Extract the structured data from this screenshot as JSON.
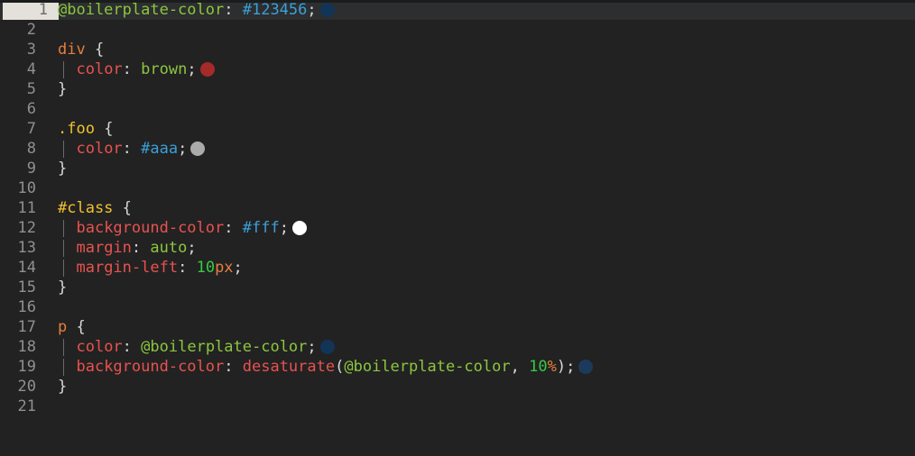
{
  "editor": {
    "language": "less",
    "background_color": "#222222",
    "active_line_background": "#2c2e2f",
    "gutter_text_color": "#8e9091",
    "active_gutter_background": "#e4e0da",
    "total_lines": 21,
    "active_line": 1
  },
  "lines": [
    {
      "number": "1",
      "active": true,
      "indent": false,
      "tokens": [
        {
          "text": "@boilerplate-color",
          "type": "var"
        },
        {
          "text": ":",
          "type": "punct"
        },
        {
          "text": " ",
          "type": "plain"
        },
        {
          "text": "#123456",
          "type": "hex"
        },
        {
          "text": ";",
          "type": "punct"
        }
      ],
      "swatch": "#123456"
    },
    {
      "number": "2",
      "active": false,
      "indent": false,
      "tokens": [],
      "swatch": null
    },
    {
      "number": "3",
      "active": false,
      "indent": false,
      "tokens": [
        {
          "text": "div",
          "type": "tag"
        },
        {
          "text": " ",
          "type": "plain"
        },
        {
          "text": "{",
          "type": "punct"
        }
      ],
      "swatch": null
    },
    {
      "number": "4",
      "active": false,
      "indent": true,
      "tokens": [
        {
          "text": "  ",
          "type": "plain"
        },
        {
          "text": "color",
          "type": "prop"
        },
        {
          "text": ":",
          "type": "punct"
        },
        {
          "text": " ",
          "type": "plain"
        },
        {
          "text": "brown",
          "type": "value"
        },
        {
          "text": ";",
          "type": "punct"
        }
      ],
      "swatch": "#a52a2a"
    },
    {
      "number": "5",
      "active": false,
      "indent": false,
      "tokens": [
        {
          "text": "}",
          "type": "punct"
        }
      ],
      "swatch": null
    },
    {
      "number": "6",
      "active": false,
      "indent": false,
      "tokens": [],
      "swatch": null
    },
    {
      "number": "7",
      "active": false,
      "indent": false,
      "tokens": [
        {
          "text": ".foo",
          "type": "selector"
        },
        {
          "text": " ",
          "type": "plain"
        },
        {
          "text": "{",
          "type": "punct"
        }
      ],
      "swatch": null
    },
    {
      "number": "8",
      "active": false,
      "indent": true,
      "tokens": [
        {
          "text": "  ",
          "type": "plain"
        },
        {
          "text": "color",
          "type": "prop"
        },
        {
          "text": ":",
          "type": "punct"
        },
        {
          "text": " ",
          "type": "plain"
        },
        {
          "text": "#aaa",
          "type": "hex"
        },
        {
          "text": ";",
          "type": "punct"
        }
      ],
      "swatch": "#aaaaaa"
    },
    {
      "number": "9",
      "active": false,
      "indent": false,
      "tokens": [
        {
          "text": "}",
          "type": "punct"
        }
      ],
      "swatch": null
    },
    {
      "number": "10",
      "active": false,
      "indent": false,
      "tokens": [],
      "swatch": null
    },
    {
      "number": "11",
      "active": false,
      "indent": false,
      "tokens": [
        {
          "text": "#class",
          "type": "selector"
        },
        {
          "text": " ",
          "type": "plain"
        },
        {
          "text": "{",
          "type": "punct"
        }
      ],
      "swatch": null
    },
    {
      "number": "12",
      "active": false,
      "indent": true,
      "tokens": [
        {
          "text": "  ",
          "type": "plain"
        },
        {
          "text": "background-color",
          "type": "prop"
        },
        {
          "text": ":",
          "type": "punct"
        },
        {
          "text": " ",
          "type": "plain"
        },
        {
          "text": "#fff",
          "type": "hex"
        },
        {
          "text": ";",
          "type": "punct"
        }
      ],
      "swatch": "#ffffff"
    },
    {
      "number": "13",
      "active": false,
      "indent": true,
      "tokens": [
        {
          "text": "  ",
          "type": "plain"
        },
        {
          "text": "margin",
          "type": "prop"
        },
        {
          "text": ":",
          "type": "punct"
        },
        {
          "text": " ",
          "type": "plain"
        },
        {
          "text": "auto",
          "type": "value"
        },
        {
          "text": ";",
          "type": "punct"
        }
      ],
      "swatch": null
    },
    {
      "number": "14",
      "active": false,
      "indent": true,
      "tokens": [
        {
          "text": "  ",
          "type": "plain"
        },
        {
          "text": "margin-left",
          "type": "prop"
        },
        {
          "text": ":",
          "type": "punct"
        },
        {
          "text": " ",
          "type": "plain"
        },
        {
          "text": "10",
          "type": "num"
        },
        {
          "text": "px",
          "type": "unit"
        },
        {
          "text": ";",
          "type": "punct"
        }
      ],
      "swatch": null
    },
    {
      "number": "15",
      "active": false,
      "indent": false,
      "tokens": [
        {
          "text": "}",
          "type": "punct"
        }
      ],
      "swatch": null
    },
    {
      "number": "16",
      "active": false,
      "indent": false,
      "tokens": [],
      "swatch": null
    },
    {
      "number": "17",
      "active": false,
      "indent": false,
      "tokens": [
        {
          "text": "p",
          "type": "tag"
        },
        {
          "text": " ",
          "type": "plain"
        },
        {
          "text": "{",
          "type": "punct"
        }
      ],
      "swatch": null
    },
    {
      "number": "18",
      "active": false,
      "indent": true,
      "tokens": [
        {
          "text": "  ",
          "type": "plain"
        },
        {
          "text": "color",
          "type": "prop"
        },
        {
          "text": ":",
          "type": "punct"
        },
        {
          "text": " ",
          "type": "plain"
        },
        {
          "text": "@boilerplate-color",
          "type": "var"
        },
        {
          "text": ";",
          "type": "punct"
        }
      ],
      "swatch": "#123456"
    },
    {
      "number": "19",
      "active": false,
      "indent": true,
      "tokens": [
        {
          "text": "  ",
          "type": "plain"
        },
        {
          "text": "background-color",
          "type": "prop"
        },
        {
          "text": ":",
          "type": "punct"
        },
        {
          "text": " ",
          "type": "plain"
        },
        {
          "text": "desaturate",
          "type": "func"
        },
        {
          "text": "(",
          "type": "punct"
        },
        {
          "text": "@boilerplate-color",
          "type": "var"
        },
        {
          "text": ",",
          "type": "punct"
        },
        {
          "text": " ",
          "type": "plain"
        },
        {
          "text": "10",
          "type": "num"
        },
        {
          "text": "%",
          "type": "unit"
        },
        {
          "text": ")",
          "type": "punct"
        },
        {
          "text": ";",
          "type": "punct"
        }
      ],
      "swatch": "#1d3a5c"
    },
    {
      "number": "20",
      "active": false,
      "indent": false,
      "tokens": [
        {
          "text": "}",
          "type": "punct"
        }
      ],
      "swatch": null
    },
    {
      "number": "21",
      "active": false,
      "indent": false,
      "tokens": [],
      "swatch": null
    }
  ]
}
